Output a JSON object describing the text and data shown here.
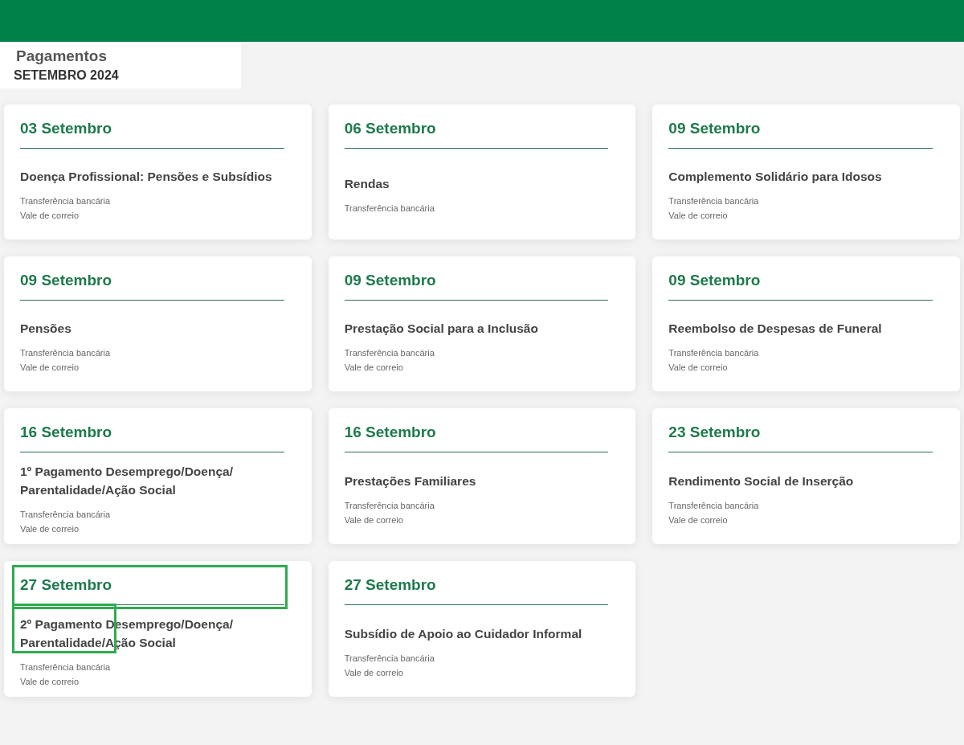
{
  "page": {
    "title": "Pagamentos",
    "subtitle": "SETEMBRO 2024"
  },
  "cards": [
    {
      "date": "03 Setembro",
      "title": "Doença Profissional: Pensões e Subsídios",
      "methods": [
        "Transferência bancária",
        "Vale de correio"
      ],
      "date_highlighted": false,
      "title_highlighted": false
    },
    {
      "date": "06 Setembro",
      "title": "Rendas",
      "methods": [
        "Transferência bancária"
      ],
      "date_highlighted": false,
      "title_highlighted": false
    },
    {
      "date": "09 Setembro",
      "title": "Complemento Solidário para Idosos",
      "methods": [
        "Transferência bancária",
        "Vale de correio"
      ],
      "date_highlighted": false,
      "title_highlighted": false
    },
    {
      "date": "09 Setembro",
      "title": "Pensões",
      "methods": [
        "Transferência bancária",
        "Vale de correio"
      ],
      "date_highlighted": false,
      "title_highlighted": false
    },
    {
      "date": "09 Setembro",
      "title": "Prestação Social para a Inclusão",
      "methods": [
        "Transferência bancária",
        "Vale de correio"
      ],
      "date_highlighted": false,
      "title_highlighted": false
    },
    {
      "date": "09 Setembro",
      "title": "Reembolso de Despesas de Funeral",
      "methods": [
        "Transferência bancária",
        "Vale de correio"
      ],
      "date_highlighted": false,
      "title_highlighted": false
    },
    {
      "date": "16 Setembro",
      "title": "1º Pagamento Desemprego/Doença/ Parentalidade/Ação Social",
      "methods": [
        "Transferência bancária",
        "Vale de correio"
      ],
      "date_highlighted": false,
      "title_highlighted": false
    },
    {
      "date": "16 Setembro",
      "title": "Prestações Familiares",
      "methods": [
        "Transferência bancária",
        "Vale de correio"
      ],
      "date_highlighted": false,
      "title_highlighted": false
    },
    {
      "date": "23 Setembro",
      "title": "Rendimento Social de Inserção",
      "methods": [
        "Transferência bancária",
        "Vale de correio"
      ],
      "date_highlighted": false,
      "title_highlighted": false
    },
    {
      "date": "27 Setembro",
      "title": "2º Pagamento Desemprego/Doença/ Parentalidade/Ação Social",
      "methods": [
        "Transferência bancária",
        "Vale de correio"
      ],
      "date_highlighted": true,
      "title_highlighted": true
    },
    {
      "date": "27 Setembro",
      "title": "Subsídio de Apoio ao Cuidador Informal",
      "methods": [
        "Transferência bancária",
        "Vale de correio"
      ],
      "date_highlighted": false,
      "title_highlighted": false
    }
  ]
}
